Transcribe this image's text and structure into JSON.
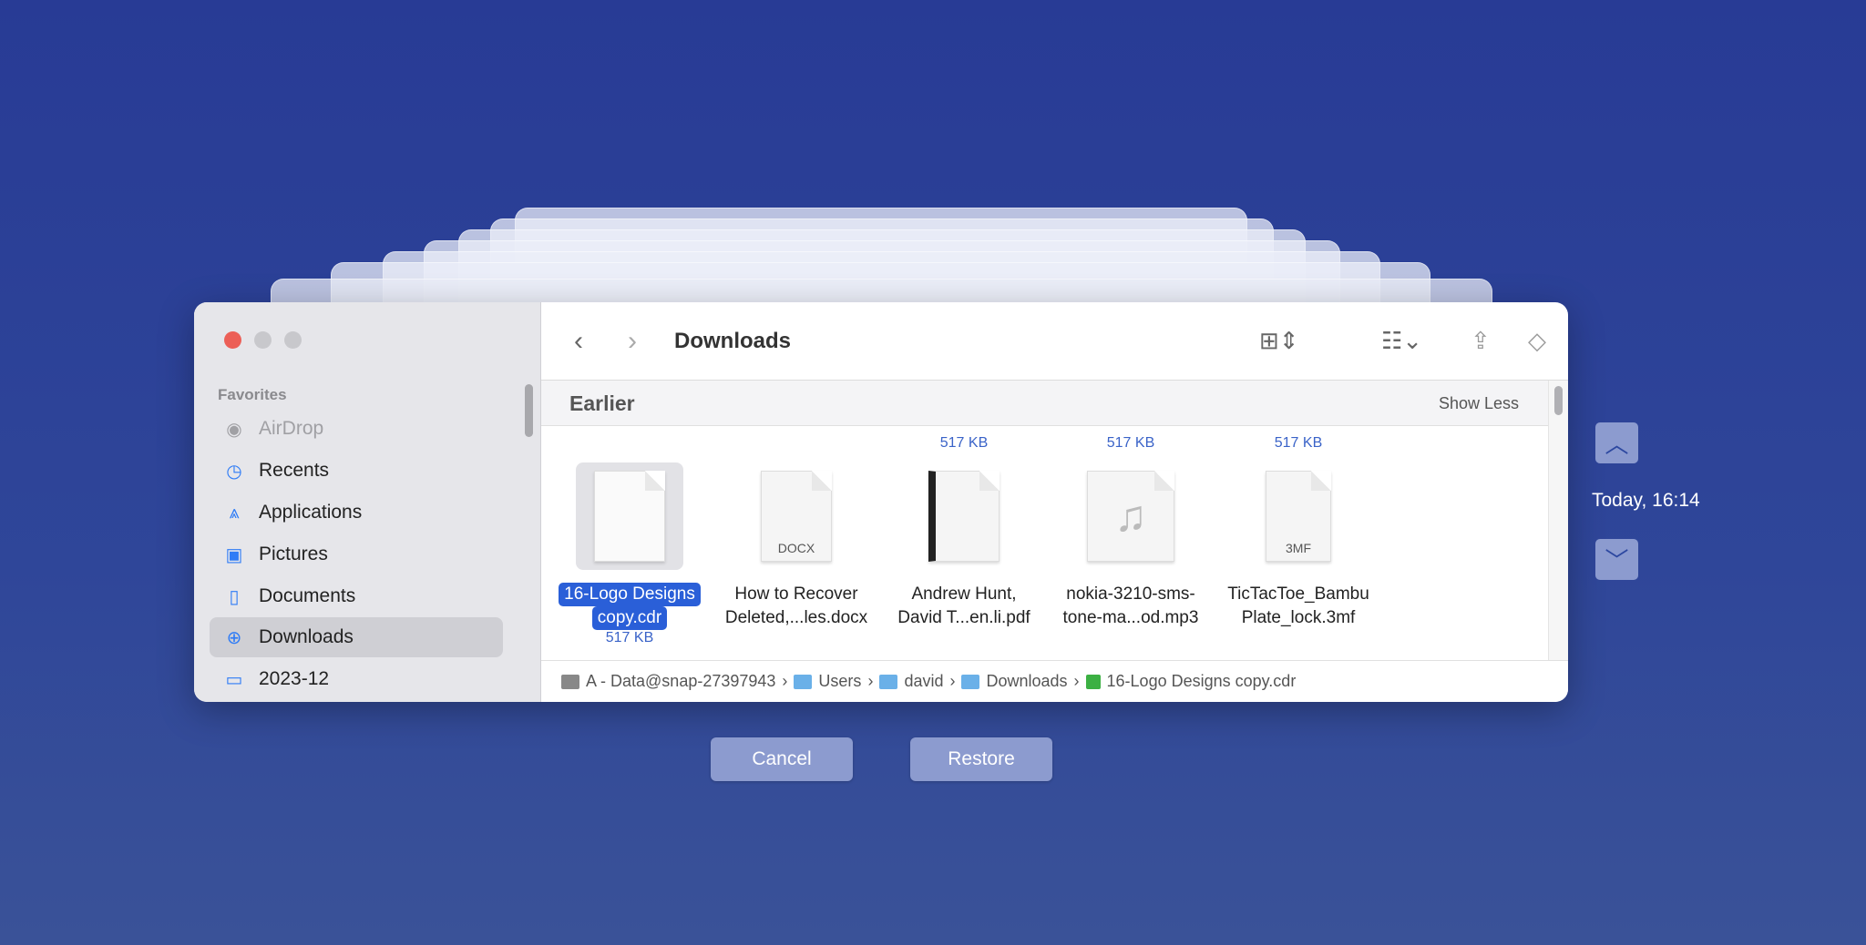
{
  "window": {
    "title": "Downloads"
  },
  "sidebar": {
    "section": "Favorites",
    "items": [
      {
        "label": "AirDrop",
        "icon": "airdrop-icon"
      },
      {
        "label": "Recents",
        "icon": "clock-icon"
      },
      {
        "label": "Applications",
        "icon": "applications-icon"
      },
      {
        "label": "Pictures",
        "icon": "photo-icon"
      },
      {
        "label": "Documents",
        "icon": "document-icon"
      },
      {
        "label": "Downloads",
        "icon": "download-icon"
      },
      {
        "label": "2023-12",
        "icon": "folder-icon"
      }
    ]
  },
  "section": {
    "title": "Earlier",
    "toggle": "Show Less"
  },
  "files": [
    {
      "name_line1": "16-Logo Designs",
      "name_line2": "copy.cdr",
      "size": "517 KB"
    },
    {
      "name_line1": "How to Recover",
      "name_line2": "Deleted,...les.docx",
      "badge": "DOCX"
    },
    {
      "name_line1": "Andrew Hunt,",
      "name_line2": "David T...en.li.pdf",
      "size": "517 KB"
    },
    {
      "name_line1": "nokia-3210-sms-",
      "name_line2": "tone-ma...od.mp3",
      "size": "517 KB"
    },
    {
      "name_line1": "TicTacToe_Bambu",
      "name_line2": "Plate_lock.3mf",
      "size": "517 KB",
      "badge": "3MF"
    }
  ],
  "path": [
    "A - Data@snap-27397943",
    "Users",
    "david",
    "Downloads",
    "16-Logo Designs copy.cdr"
  ],
  "buttons": {
    "cancel": "Cancel",
    "restore": "Restore"
  },
  "timeline": {
    "time": "Today, 16:14"
  }
}
